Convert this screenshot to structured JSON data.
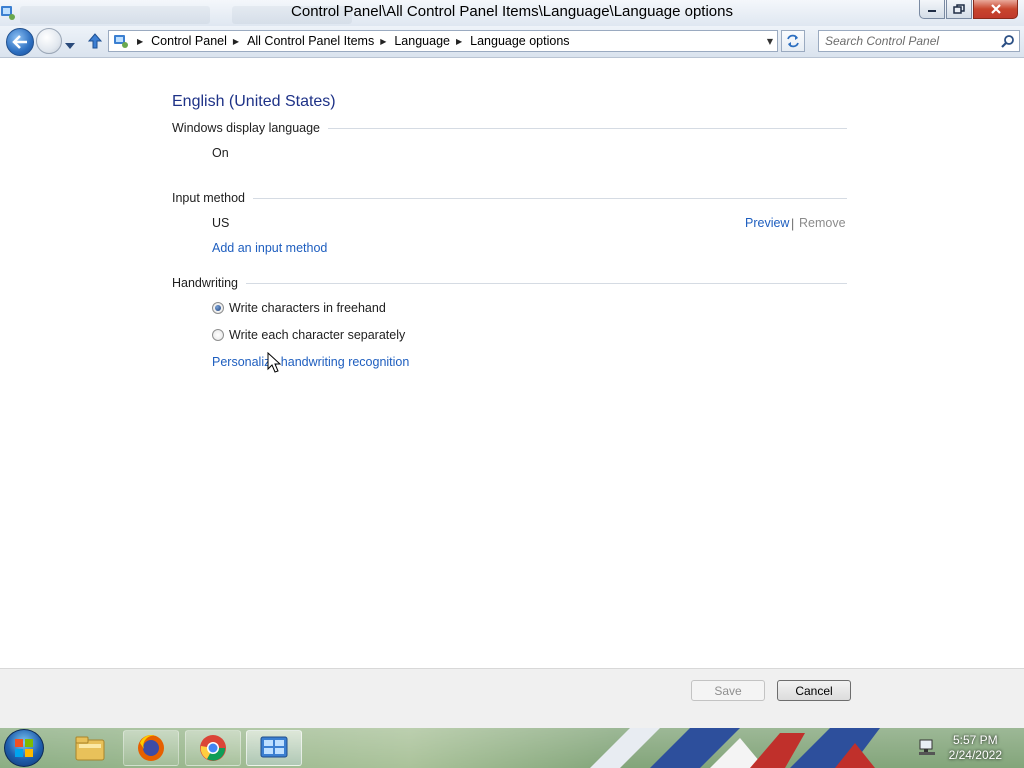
{
  "window": {
    "title": "Control Panel\\All Control Panel Items\\Language\\Language options"
  },
  "navbar": {
    "breadcrumbs": [
      "Control Panel",
      "All Control Panel Items",
      "Language",
      "Language options"
    ],
    "search_placeholder": "Search Control Panel"
  },
  "content": {
    "language_title": "English (United States)",
    "display_language": {
      "label": "Windows display language",
      "value": "On"
    },
    "input_method": {
      "label": "Input method",
      "method": "US",
      "preview_link": "Preview",
      "separator": "|",
      "remove_link": "Remove",
      "add_link": "Add an input method"
    },
    "handwriting": {
      "label": "Handwriting",
      "options": [
        {
          "label": "Write characters in freehand",
          "checked": true
        },
        {
          "label": "Write each character separately",
          "checked": false
        }
      ],
      "personalize_link": "Personalize handwriting recognition"
    }
  },
  "footer": {
    "save_label": "Save",
    "cancel_label": "Cancel"
  },
  "taskbar": {
    "time": "5:57 PM",
    "date": "2/24/2022"
  },
  "colors": {
    "link": "#1e5ebf",
    "title_blue": "#1e3287",
    "disabled": "#8b8b8b"
  }
}
